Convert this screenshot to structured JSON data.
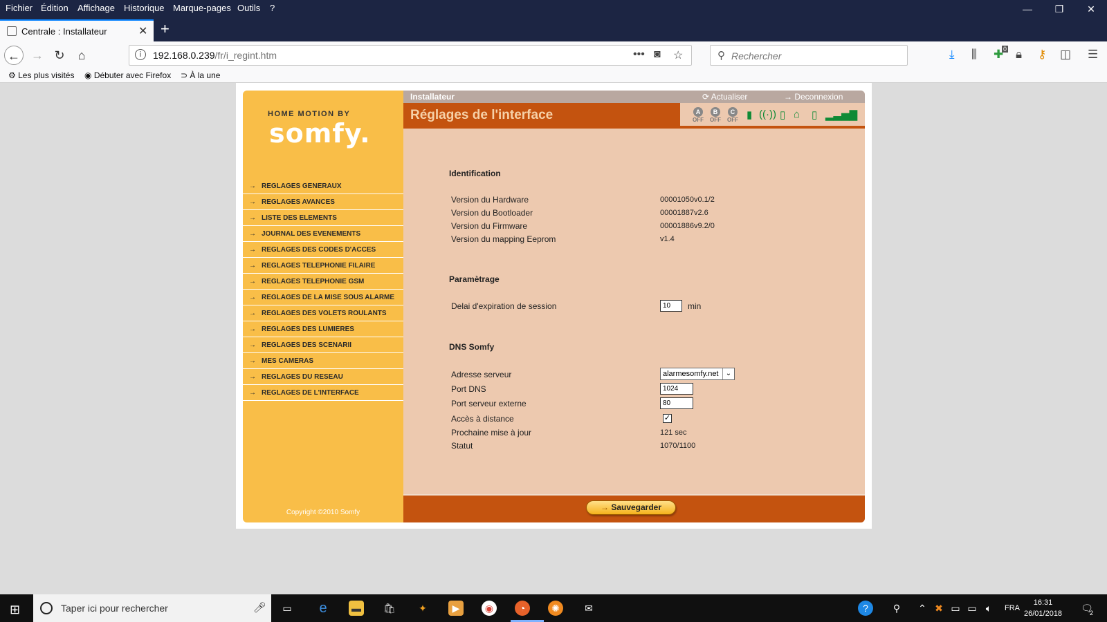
{
  "menubar": {
    "items": [
      {
        "label": "Fichier"
      },
      {
        "label": "Édition"
      },
      {
        "label": "Affichage"
      },
      {
        "label": "Historique"
      },
      {
        "label": "Marque-pages"
      },
      {
        "label": "Outils"
      },
      {
        "label": "?"
      }
    ]
  },
  "window_controls": {
    "minimize": "—",
    "restore": "❐",
    "close": "✕"
  },
  "tab": {
    "title": "Centrale : Installateur",
    "close": "✕"
  },
  "newtab_label": "+",
  "navbar": {
    "url_host": "192.168.0.239",
    "url_path": "/fr/i_regint.htm",
    "search_placeholder": "Rechercher",
    "badge_count": "0"
  },
  "bookmarks": [
    {
      "label": "Les plus visités"
    },
    {
      "label": "Débuter avec Firefox"
    },
    {
      "label": "À la une"
    }
  ],
  "sidebar": {
    "logo_top": "HOME MOTION BY",
    "logo_main": "somfy.",
    "nav": [
      {
        "label": "REGLAGES GENERAUX"
      },
      {
        "label": "REGLAGES AVANCES"
      },
      {
        "label": "LISTE DES ELEMENTS"
      },
      {
        "label": "JOURNAL DES EVENEMENTS"
      },
      {
        "label": "REGLAGES DES CODES D'ACCES"
      },
      {
        "label": "REGLAGES TELEPHONIE FILAIRE"
      },
      {
        "label": "REGLAGES TELEPHONIE GSM"
      },
      {
        "label": "REGLAGES DE LA MISE SOUS ALARME"
      },
      {
        "label": "REGLAGES DES VOLETS ROULANTS"
      },
      {
        "label": "REGLAGES DES LUMIERES"
      },
      {
        "label": "REGLAGES DES SCENARII"
      },
      {
        "label": "MES CAMERAS"
      },
      {
        "label": "REGLAGES DU RESEAU"
      },
      {
        "label": "REGLAGES DE L'INTERFACE"
      }
    ],
    "copyright": "Copyright ©2010 Somfy"
  },
  "header": {
    "role": "Installateur",
    "refresh": "Actualiser",
    "logout": "Deconnexion",
    "title": "Réglages de l'interface",
    "zones": [
      {
        "letter": "A",
        "state": "OFF"
      },
      {
        "letter": "B",
        "state": "OFF"
      },
      {
        "letter": "C",
        "state": "OFF"
      }
    ]
  },
  "identification": {
    "title": "Identification",
    "rows": [
      {
        "label": "Version du Hardware",
        "value": "00001050v0.1/2"
      },
      {
        "label": "Version du Bootloader",
        "value": "00001887v2.6"
      },
      {
        "label": "Version du Firmware",
        "value": "00001886v9.2/0"
      },
      {
        "label": "Version du mapping Eeprom",
        "value": "v1.4"
      }
    ]
  },
  "parametrage": {
    "title": "Paramètrage",
    "session_label": "Delai d'expiration de session",
    "session_value": "10",
    "session_unit": "min"
  },
  "dns": {
    "title": "DNS Somfy",
    "server_label": "Adresse serveur",
    "server_value": "alarmesomfy.net",
    "port_dns_label": "Port DNS",
    "port_dns_value": "1024",
    "port_ext_label": "Port serveur externe",
    "port_ext_value": "80",
    "remote_label": "Accès à distance",
    "remote_checked": true,
    "next_update_label": "Prochaine mise à jour",
    "next_update_value": "121 sec",
    "status_label": "Statut",
    "status_value": "1070/1100"
  },
  "footer": {
    "save_label": "Sauvegarder"
  },
  "taskbar": {
    "search_placeholder": "Taper ici pour rechercher",
    "lang": "FRA",
    "time": "16:31",
    "date": "26/01/2018",
    "notif_count": "2"
  },
  "colors": {
    "sidebar": "#f9be48",
    "main_bg": "#edc9af",
    "accent": "#c4530f",
    "chrome": "#1c2543"
  }
}
